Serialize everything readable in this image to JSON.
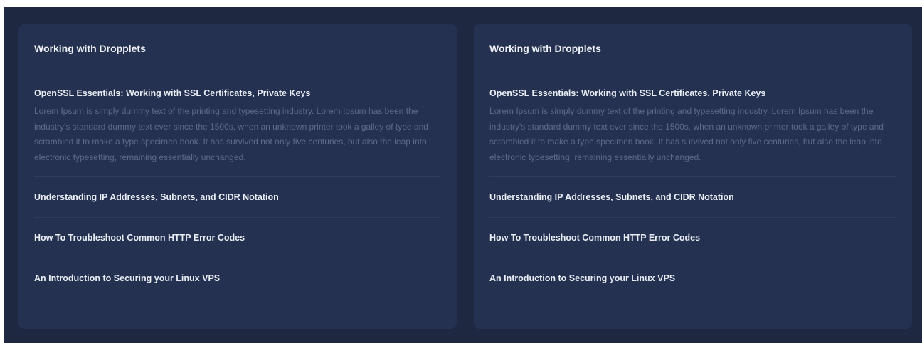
{
  "cards": [
    {
      "title": "Working with Dropplets",
      "items": [
        {
          "title": "OpenSSL Essentials: Working with SSL Certificates, Private Keys",
          "body": "Lorem Ipsum is simply dummy text of the printing and typesetting industry. Lorem Ipsum has been the industry's standard dummy text ever since the 1500s, when an unknown printer took a galley of type and scrambled it to make a type specimen book. It has survived not only five centuries, but also the leap into electronic typesetting, remaining essentially unchanged."
        },
        {
          "title": "Understanding IP Addresses, Subnets, and CIDR Notation"
        },
        {
          "title": "How To Troubleshoot Common HTTP Error Codes"
        },
        {
          "title": "An Introduction to Securing your Linux VPS"
        }
      ]
    },
    {
      "title": "Working with Dropplets",
      "items": [
        {
          "title": "OpenSSL Essentials: Working with SSL Certificates, Private Keys",
          "body": "Lorem Ipsum is simply dummy text of the printing and typesetting industry. Lorem Ipsum has been the industry's standard dummy text ever since the 1500s, when an unknown printer took a galley of type and scrambled it to make a type specimen book. It has survived not only five centuries, but also the leap into electronic typesetting, remaining essentially unchanged."
        },
        {
          "title": "Understanding IP Addresses, Subnets, and CIDR Notation"
        },
        {
          "title": "How To Troubleshoot Common HTTP Error Codes"
        },
        {
          "title": "An Introduction to Securing your Linux VPS"
        }
      ]
    }
  ],
  "colors": {
    "background": "#1e2841",
    "card": "#243150",
    "title": "#eef1f7",
    "body_text": "#5e6b88",
    "divider": "#2f3c5c"
  }
}
